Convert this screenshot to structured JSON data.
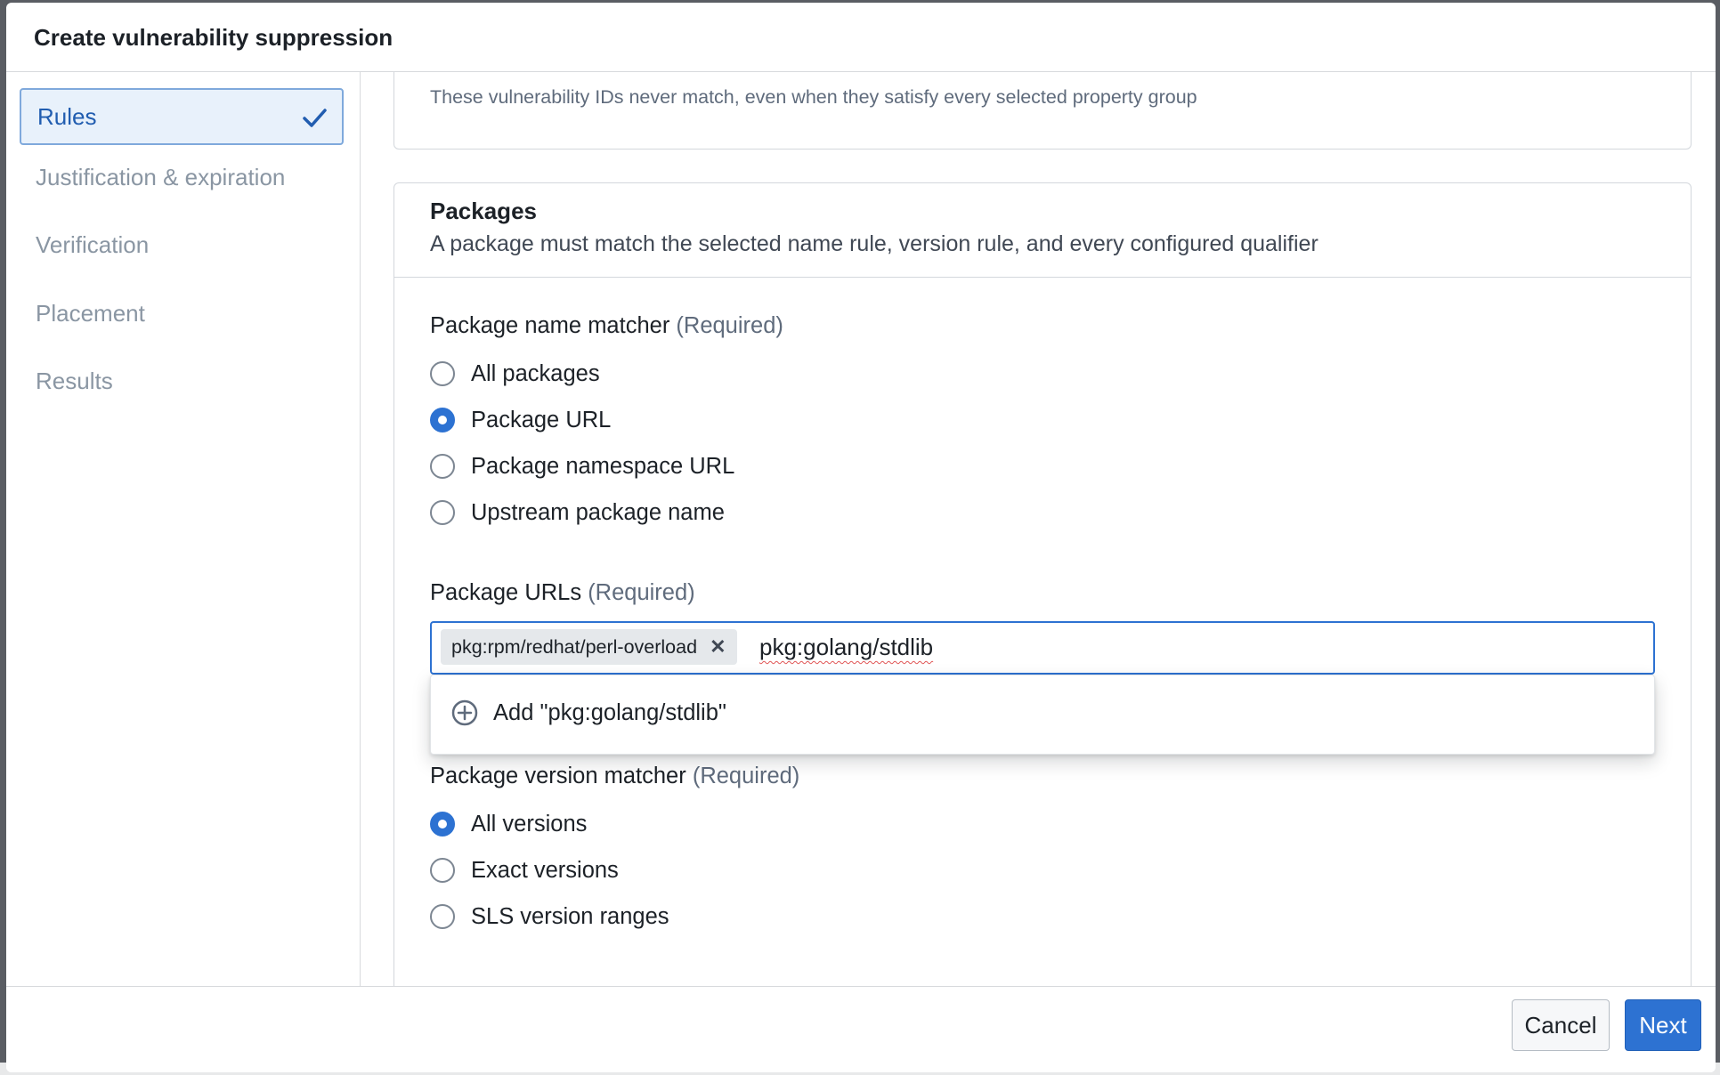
{
  "dialog": {
    "title": "Create vulnerability suppression"
  },
  "steps": [
    {
      "label": "Rules",
      "state": "active",
      "completed": true
    },
    {
      "label": "Justification & expiration",
      "state": "inactive"
    },
    {
      "label": "Verification",
      "state": "inactive"
    },
    {
      "label": "Placement",
      "state": "inactive"
    },
    {
      "label": "Results",
      "state": "inactive"
    }
  ],
  "vulnerability_ids_card": {
    "hint": "These vulnerability IDs never match, even when they satisfy every selected property group"
  },
  "packages": {
    "title": "Packages",
    "subtitle": "A package must match the selected name rule, version rule, and every configured qualifier",
    "name_matcher": {
      "label": "Package name matcher",
      "required": "(Required)",
      "options": [
        "All packages",
        "Package URL",
        "Package namespace URL",
        "Upstream package name"
      ],
      "selected": "Package URL"
    },
    "urls": {
      "label": "Package URLs",
      "required": "(Required)",
      "tags": [
        "pkg:rpm/redhat/perl-overload"
      ],
      "tag_remove_glyph": "✕",
      "input_value": "pkg:golang/stdlib",
      "suggestion": "Add \"pkg:golang/stdlib\""
    },
    "version_matcher": {
      "label": "Package version matcher",
      "required": "(Required)",
      "options": [
        "All versions",
        "Exact versions",
        "SLS version ranges"
      ],
      "selected": "All versions"
    }
  },
  "footer": {
    "cancel_label": "Cancel",
    "next_label": "Next"
  },
  "colors": {
    "accent": "#2d72d2",
    "active_step_bg": "#e8f1fb",
    "muted_text": "#8a96a3"
  },
  "icons": {
    "step_complete": "check-icon",
    "add_option": "plus-circle-icon",
    "tag_remove": "close-icon"
  }
}
